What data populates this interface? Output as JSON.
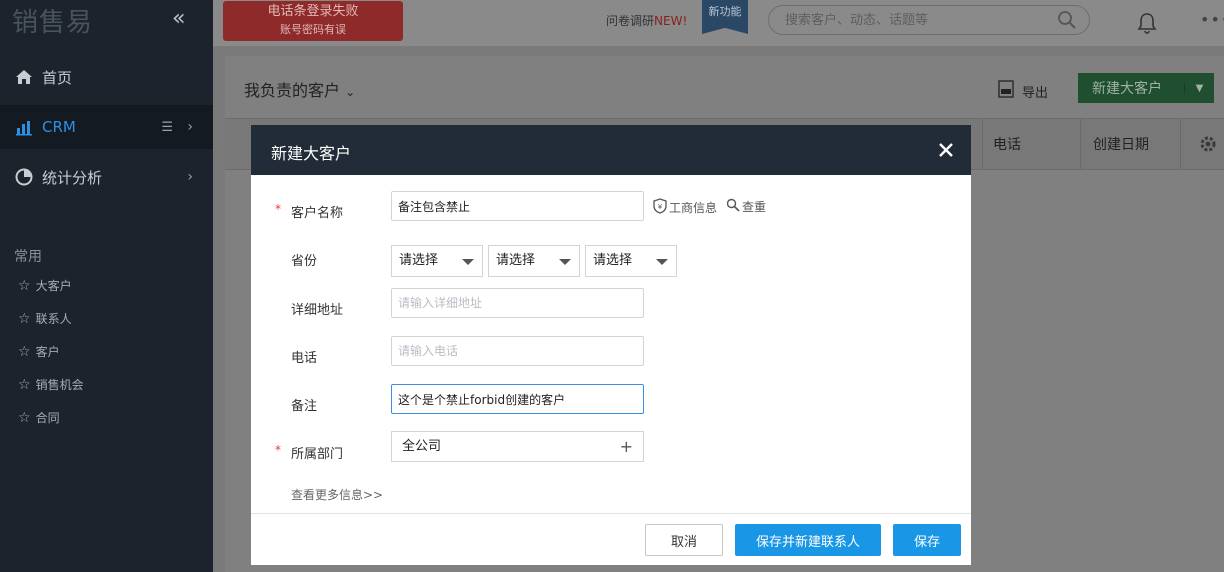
{
  "sidebar": {
    "logo": "销售易",
    "nav": [
      {
        "label": "首页",
        "icon": "home-icon"
      },
      {
        "label": "CRM",
        "icon": "bar-chart-icon"
      },
      {
        "label": "统计分析",
        "icon": "pie-chart-icon"
      }
    ],
    "section_title": "常用",
    "favorites": [
      "大客户",
      "联系人",
      "客户",
      "销售机会",
      "合同"
    ]
  },
  "topbar": {
    "error_title": "电话条登录失败",
    "error_sub": "账号密码有误",
    "survey_label": "问卷调研",
    "survey_new": "NEW!",
    "new_feature": "新功能",
    "search_placeholder": "搜索客户、动态、话题等"
  },
  "page": {
    "title": "我负责的客户",
    "export_label": "导出",
    "new_button": "新建大客户",
    "columns": [
      "电话",
      "创建日期"
    ]
  },
  "modal": {
    "title": "新建大客户",
    "fields": {
      "name_label": "客户名称",
      "name_value": "备注包含禁止",
      "biz_info": "工商信息",
      "dup_check": "查重",
      "province_label": "省份",
      "selects": [
        "请选择",
        "请选择",
        "请选择"
      ],
      "address_label": "详细地址",
      "address_placeholder": "请输入详细地址",
      "phone_label": "电话",
      "phone_placeholder": "请输入电话",
      "note_label": "备注",
      "note_value": "这个是个禁止forbid创建的客户",
      "dept_label": "所属部门",
      "dept_value": "全公司"
    },
    "more_info": "查看更多信息>>",
    "buttons": {
      "cancel": "取消",
      "save_new_contact": "保存并新建联系人",
      "save": "保存"
    }
  },
  "colors": {
    "primary": "#1a96e6",
    "sidebar_bg": "#1c232d",
    "modal_header": "#222b38",
    "required": "#e23a3a"
  }
}
